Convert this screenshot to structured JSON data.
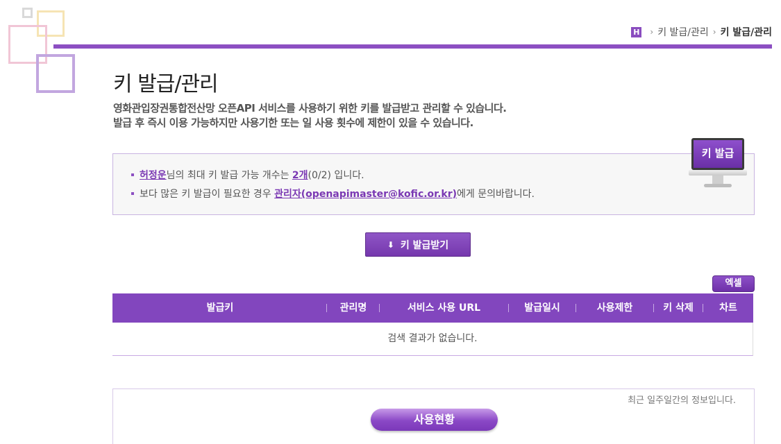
{
  "breadcrumb": {
    "home_label": "H",
    "parent": "키 발급/관리",
    "current": "키 발급/관리"
  },
  "page": {
    "title": "키 발급/관리",
    "desc_line1": "영화관입장권통합전산망 오픈API 서비스를 사용하기 위한 키를 발급받고 관리할 수 있습니다.",
    "desc_line2": "발급 후 즉시 이용 가능하지만 사용기한 또는 일 사용 횟수에 제한이 있을 수 있습니다."
  },
  "info": {
    "user_name": "허정운",
    "line1_mid": "님의 최대 키 발급 가능 개수는 ",
    "max_count": "2개",
    "line1_end": "(0/2) 입니다.",
    "line2_start": "보다 많은 키 발급이 필요한 경우 ",
    "admin_link": "관리자(openapimaster@kofic.or.kr)",
    "line2_end": "에게 문의바랍니다.",
    "monitor_label": "키 발급"
  },
  "buttons": {
    "issue_key": "키 발급받기",
    "excel": "엑셀",
    "usage": "사용현황"
  },
  "table": {
    "headers": [
      "발급키",
      "관리명",
      "서비스 사용 URL",
      "발급일시",
      "사용제한",
      "키 삭제",
      "차트"
    ],
    "empty_message": "검색 결과가 없습니다."
  },
  "usage": {
    "note": "최근 일주일간의 정보입니다."
  },
  "colors": {
    "accent": "#8246be",
    "link": "#7a38b3"
  }
}
